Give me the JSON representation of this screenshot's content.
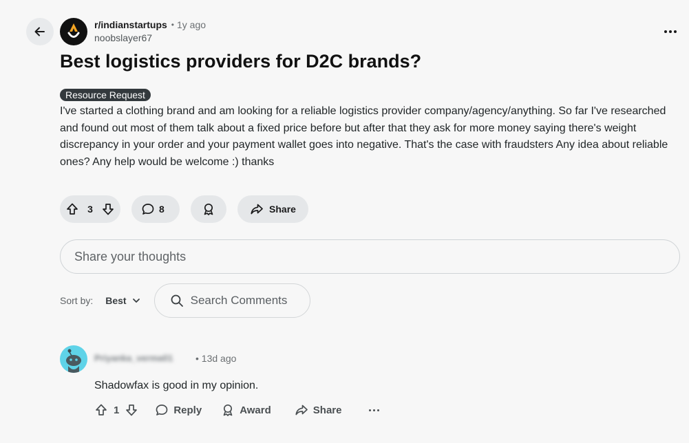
{
  "post": {
    "subreddit": "r/indianstartups",
    "separator": "•",
    "age": "1y ago",
    "author": "noobslayer67",
    "title": "Best logistics providers for D2C brands?",
    "flair": "Resource Request",
    "body": "I've started a clothing brand and am looking for a reliable logistics provider company/agency/anything. So far I've researched and found out most of them talk about a fixed price before but after that they ask for more money saying there's weight discrepancy in your order and your payment wallet goes into negative. That's the case with fraudsters Any idea about reliable ones? Any help would be welcome :) thanks",
    "upvotes": "3",
    "comments_count": "8",
    "share_label": "Share"
  },
  "composer": {
    "placeholder": "Share your thoughts"
  },
  "sort": {
    "label": "Sort by:",
    "value": "Best",
    "search_placeholder": "Search Comments"
  },
  "comment": {
    "author": "Priyanka_verma01",
    "separator": "•",
    "age": "13d ago",
    "text": "Shadowfax is good in my opinion.",
    "votes": "1",
    "reply_label": "Reply",
    "award_label": "Award",
    "share_label": "Share"
  },
  "colors": {
    "page_bg": "#f7f7f7",
    "pill_bg": "#e5e7e9",
    "flair_bg": "#33393d",
    "comment_avatar_bg": "#5fd3e8",
    "subreddit_logo_accent": "#f5a623"
  },
  "icons": {
    "back": "arrow-left-icon",
    "upvote": "arrow-up-icon",
    "downvote": "arrow-down-icon",
    "comments": "speech-bubble-icon",
    "award": "award-icon",
    "share": "share-arrow-icon",
    "search": "search-icon",
    "chevron": "chevron-down-icon",
    "more": "ellipsis-icon"
  }
}
